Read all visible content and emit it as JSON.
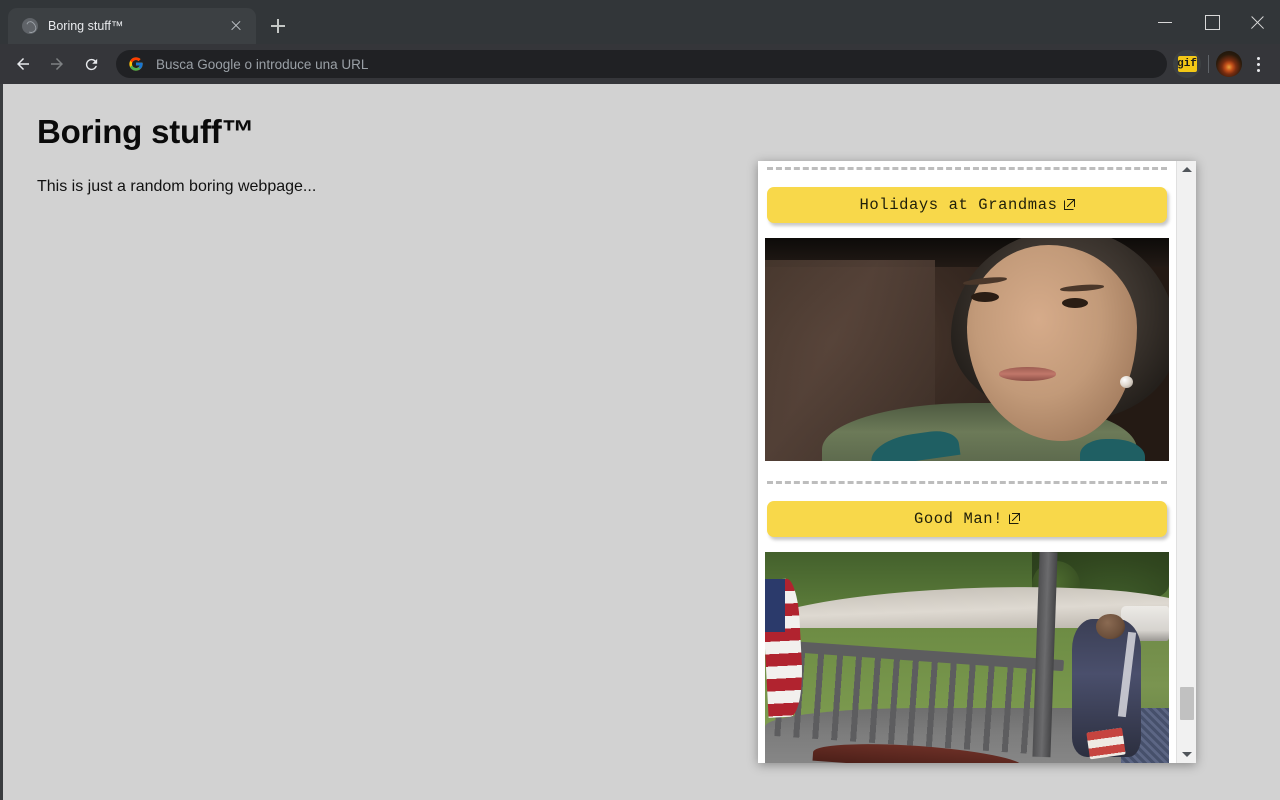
{
  "browser": {
    "tab": {
      "title": "Boring stuff™",
      "favicon_name": "globe-favicon",
      "close_label": "×"
    },
    "new_tab_label": "+",
    "window_controls": {
      "minimize_label": "—",
      "maximize_label": "□",
      "close_label": "✕"
    },
    "toolbar": {
      "back_label": "Back",
      "forward_label": "Forward",
      "reload_label": "Reload",
      "omnibox_placeholder": "Busca Google o introduce una URL",
      "omnibox_value": "",
      "extension_badge_label": "gif",
      "profile_label": "Profile",
      "menu_label": "Customize and control Google Chrome"
    },
    "theme": {
      "tabstrip_bg": "#323639",
      "toolbar_bg": "#35363A",
      "active_tab_bg": "#3C4043",
      "omnibox_bg": "#202124",
      "text": "#E8EAED"
    }
  },
  "page": {
    "title": "Boring stuff™",
    "paragraph": "This is just a random boring webpage...",
    "background": "#D2D2D2"
  },
  "popup": {
    "accent_color": "#F8D84A",
    "items": [
      {
        "button_label": "Holidays at Grandmas",
        "link_icon": "external-link-icon",
        "media_name": "grandma-interview-gif",
        "media_alt": "Close-up of an older woman with short dark hair wearing a green jacket, looking slightly off camera"
      },
      {
        "button_label": "Good Man!",
        "link_icon": "external-link-icon",
        "media_name": "porch-doorbell-camera-gif",
        "media_alt": "Doorbell camera view of a delivery driver placing a package on a porch with an American flag and a gravel driveway"
      }
    ],
    "scrollbar": {
      "up_arrow": "▲",
      "down_arrow": "▼",
      "thumb_label": "scroll thumb"
    }
  }
}
